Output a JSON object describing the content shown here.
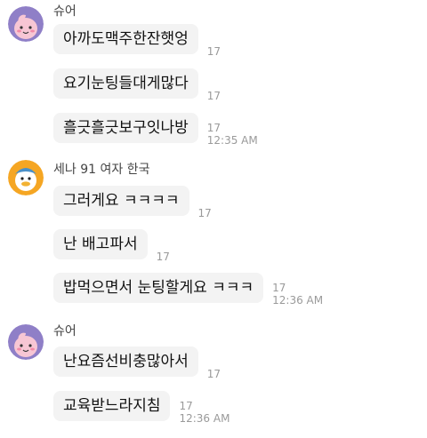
{
  "groups": [
    {
      "sender": "슈어",
      "avatar": "peach-character-icon",
      "messages": [
        {
          "text": "아까도맥주한잔햇엉",
          "count": "17",
          "time": ""
        },
        {
          "text": "요기눈팅들대게많다",
          "count": "17",
          "time": ""
        },
        {
          "text": "흘긋흘긋보구잇나방",
          "count": "17",
          "time": "12:35 AM"
        }
      ]
    },
    {
      "sender": "세나 91 여자 한국",
      "avatar": "duck-character-icon",
      "messages": [
        {
          "text": "그러게요 ㅋㅋㅋㅋ",
          "count": "17",
          "time": ""
        },
        {
          "text": "난 배고파서",
          "count": "17",
          "time": ""
        },
        {
          "text": "밥먹으면서 눈팅할게요 ㅋㅋㅋ",
          "count": "17",
          "time": "12:36 AM"
        }
      ]
    },
    {
      "sender": "슈어",
      "avatar": "peach-character-icon",
      "messages": [
        {
          "text": "난요즘선비충많아서",
          "count": "17",
          "time": ""
        },
        {
          "text": "교육받느라지침",
          "count": "17",
          "time": "12:36 AM"
        }
      ]
    }
  ]
}
